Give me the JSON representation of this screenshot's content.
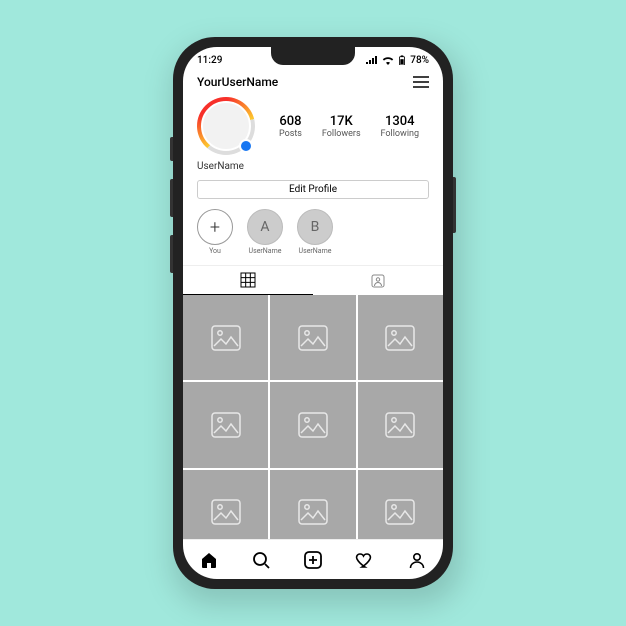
{
  "status": {
    "time": "11:29",
    "battery": "78%"
  },
  "header": {
    "username": "YourUserName"
  },
  "profile": {
    "displayName": "UserName",
    "stats": {
      "posts": {
        "count": "608",
        "label": "Posts"
      },
      "followers": {
        "count": "17K",
        "label": "Followers"
      },
      "following": {
        "count": "1304",
        "label": "Following"
      }
    },
    "editLabel": "Edit Profile"
  },
  "highlights": {
    "new": {
      "label": "You",
      "glyph": "+"
    },
    "items": [
      {
        "letter": "A",
        "label": "UserName"
      },
      {
        "letter": "B",
        "label": "UserName"
      }
    ]
  }
}
